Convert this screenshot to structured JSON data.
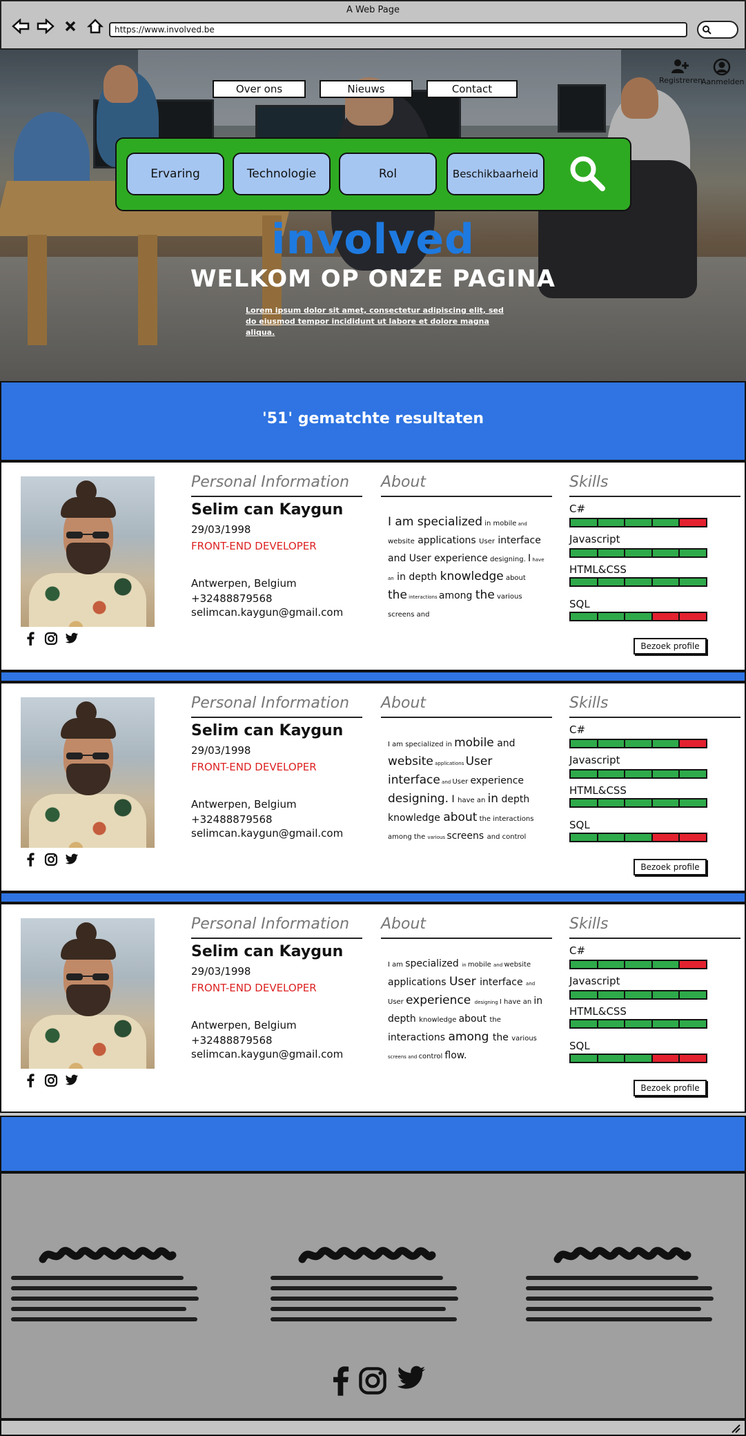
{
  "browser": {
    "title": "A Web Page",
    "url": "https://www.involved.be"
  },
  "nav": {
    "links": [
      "Over ons",
      "Nieuws",
      "Contact"
    ],
    "register_label": "Registreren",
    "login_label": "Aanmelden"
  },
  "filters": {
    "items": [
      "Ervaring",
      "Technologie",
      "Rol",
      "Beschikbaarheid"
    ]
  },
  "hero": {
    "brand": "involved",
    "welcome": "WELKOM OP ONZE PAGINA",
    "lorem": "Lorem ipsum dolor sit amet, consectetur adipiscing elit, sed do eiusmod tempor incididunt ut labore et dolore magna aliqua."
  },
  "results": {
    "text": "'51' gematchte resultaten"
  },
  "sections": {
    "personal": "Personal Information",
    "about": "About",
    "skills": "Skills",
    "visit": "Bezoek profile"
  },
  "profiles": [
    {
      "name": "Selim can Kaygun",
      "dob": "29/03/1998",
      "role": "FRONT-END DEVELOPER",
      "city": "Antwerpen, Belgium",
      "phone": "+32488879568",
      "email": "selimcan.kaygun@gmail.com",
      "skills": [
        {
          "label": "C#",
          "level": 4
        },
        {
          "label": "Javascript",
          "level": 5
        },
        {
          "label": "HTML&CSS",
          "level": 5
        },
        {
          "label": "SQL",
          "level": 3
        }
      ]
    },
    {
      "name": "Selim can Kaygun",
      "dob": "29/03/1998",
      "role": "FRONT-END DEVELOPER",
      "city": "Antwerpen, Belgium",
      "phone": "+32488879568",
      "email": "selimcan.kaygun@gmail.com",
      "skills": [
        {
          "label": "C#",
          "level": 4
        },
        {
          "label": "Javascript",
          "level": 5
        },
        {
          "label": "HTML&CSS",
          "level": 5
        },
        {
          "label": "SQL",
          "level": 3
        }
      ]
    },
    {
      "name": "Selim can Kaygun",
      "dob": "29/03/1998",
      "role": "FRONT-END DEVELOPER",
      "city": "Antwerpen, Belgium",
      "phone": "+32488879568",
      "email": "selimcan.kaygun@gmail.com",
      "skills": [
        {
          "label": "C#",
          "level": 4
        },
        {
          "label": "Javascript",
          "level": 5
        },
        {
          "label": "HTML&CSS",
          "level": 5
        },
        {
          "label": "SQL",
          "level": 3
        }
      ]
    }
  ],
  "colors": {
    "brand_blue": "#1e7ae0",
    "band_blue": "#2f74e2",
    "filter_green": "#2eaa22",
    "skill_on": "#2eaa4a",
    "skill_off": "#e3212f",
    "role_red": "#dd2222"
  },
  "icons": [
    "back-icon",
    "forward-icon",
    "close-icon",
    "home-icon",
    "search-icon",
    "add-user-icon",
    "user-icon",
    "facebook-icon",
    "instagram-icon",
    "twitter-icon"
  ]
}
